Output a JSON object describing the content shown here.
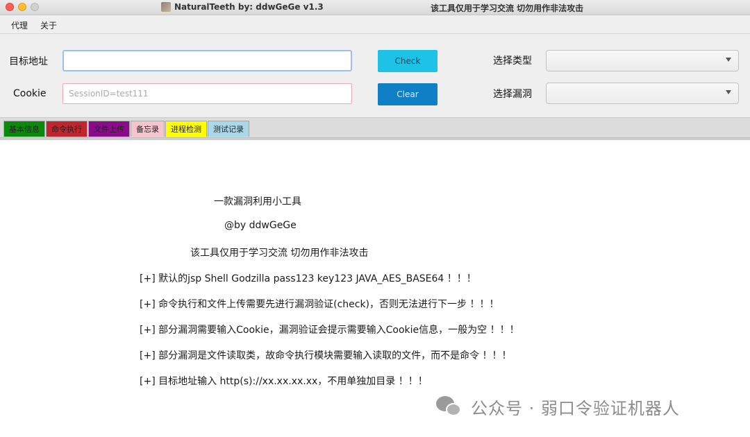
{
  "window": {
    "title": "NaturalTeeth  by: ddwGeGe v1.3",
    "title_warning": "该工具仅用于学习交流 切勿用作非法攻击"
  },
  "menu": {
    "items": [
      {
        "label": "代理"
      },
      {
        "label": "关于"
      }
    ]
  },
  "form": {
    "target_label": "目标地址",
    "target_value": "",
    "cookie_label": "Cookie",
    "cookie_placeholder": "SessionID=test111",
    "check_button": "Check",
    "clear_button": "Clear",
    "type_label": "选择类型",
    "type_selected": "",
    "vuln_label": "选择漏洞",
    "vuln_selected": ""
  },
  "tabs": [
    {
      "label": "基本信息",
      "color": "#0a8a0a"
    },
    {
      "label": "命令执行",
      "color": "#c0262d"
    },
    {
      "label": "文件上传",
      "color": "#8b0b8b"
    },
    {
      "label": "备忘录",
      "color": "#f7c3cf"
    },
    {
      "label": "进程检测",
      "color": "#ffff00"
    },
    {
      "label": "测试记录",
      "color": "#a9d8ea"
    }
  ],
  "content": {
    "heading": "一款漏洞利用小工具",
    "author": "@by ddwGeGe",
    "warning": "该工具仅用于学习交流 切勿用作非法攻击",
    "notes": [
      "[+] 默认的jsp Shell Godzilla pass123 key123 JAVA_AES_BASE64 ！！！",
      "[+] 命令执行和文件上传需要先进行漏洞验证(check)，否则无法进行下一步 ！！！",
      "[+] 部分漏洞需要输入Cookie，漏洞验证会提示需要输入Cookie信息，一般为空 ！！！",
      "[+] 部分漏洞是文件读取类，故命令执行模块需要输入读取的文件，而不是命令 ！！！",
      "[+] 目标地址输入 http(s)://xx.xx.xx.xx，不用单独加目录 ！！！"
    ]
  },
  "watermark": {
    "text": "公众号 · 弱口令验证机器人",
    "icon": "wechat-icon"
  }
}
